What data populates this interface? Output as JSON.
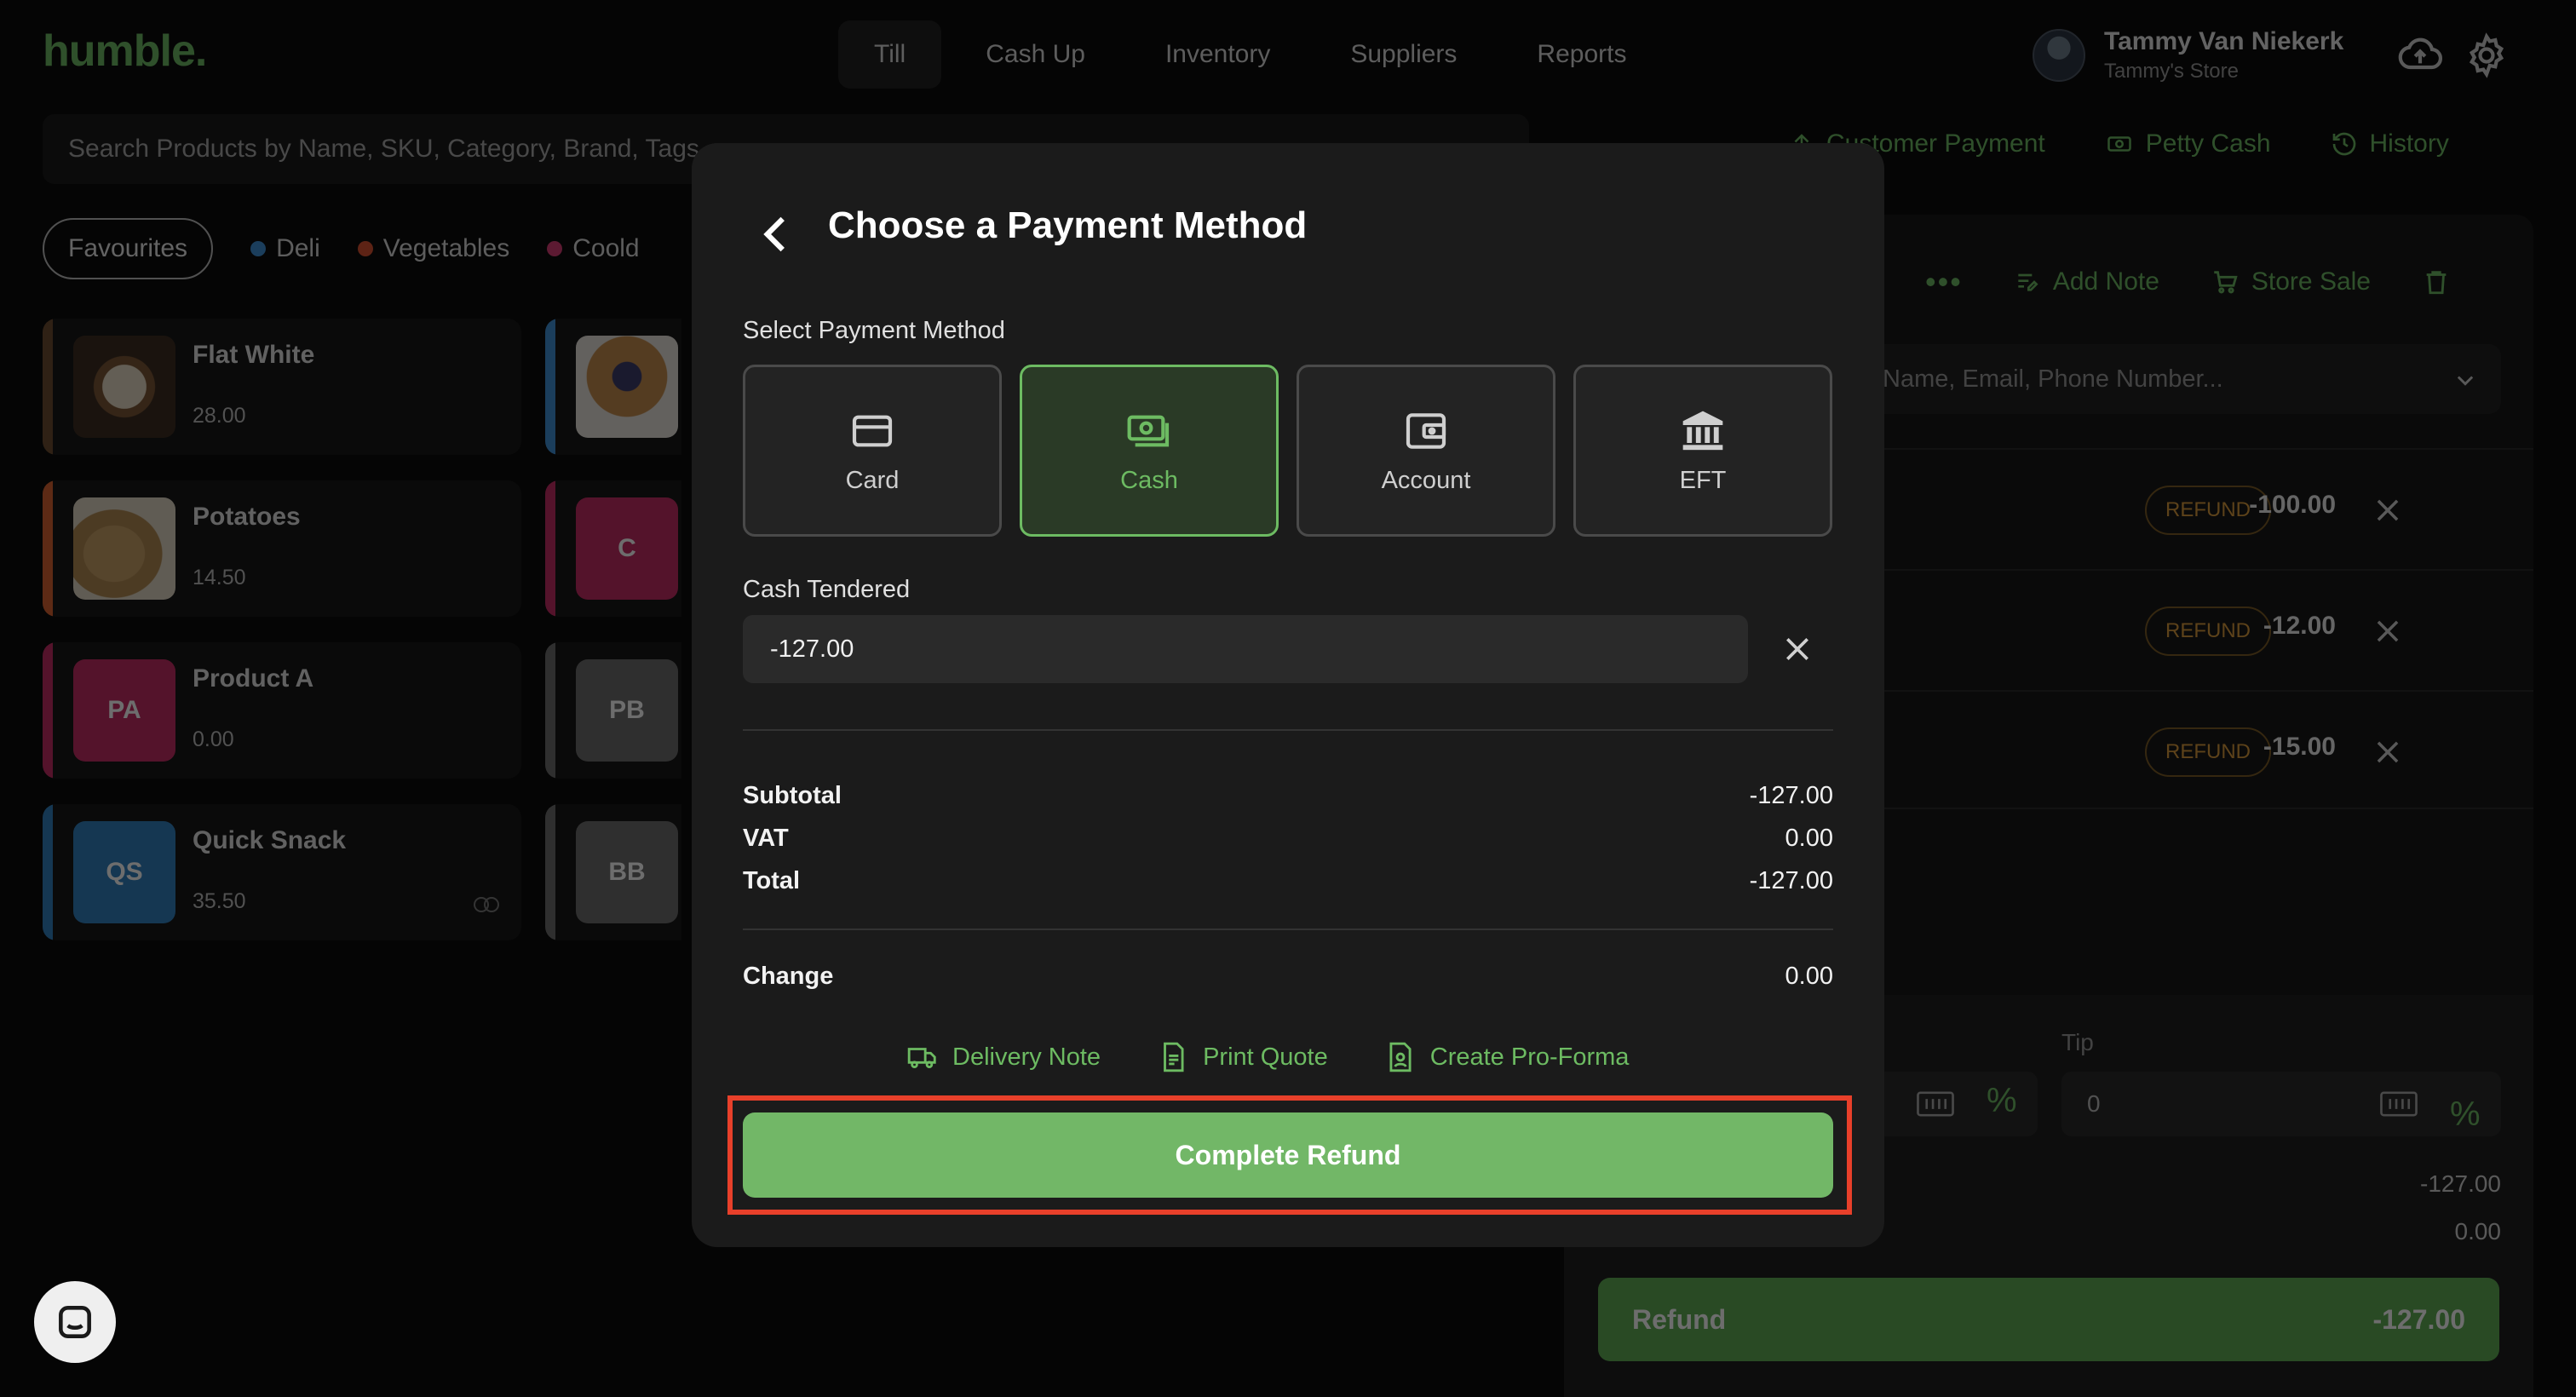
{
  "app": {
    "logo": "humble."
  },
  "nav": {
    "tabs": [
      "Till",
      "Cash Up",
      "Inventory",
      "Suppliers",
      "Reports"
    ],
    "active": "Till"
  },
  "user": {
    "name": "Tammy Van Niekerk",
    "store": "Tammy's Store"
  },
  "icons": {
    "sync": "cloud-upload-icon",
    "settings": "gear-icon"
  },
  "search": {
    "placeholder": "Search Products by Name, SKU, Category, Brand, Tags"
  },
  "categories": {
    "favourites": "Favourites",
    "items": [
      {
        "label": "Deli",
        "color": "#3d8fd6"
      },
      {
        "label": "Vegetables",
        "color": "#d8502e"
      },
      {
        "label": "Coold",
        "color": "#d63a72"
      }
    ]
  },
  "products": [
    {
      "name": "Flat White",
      "price": "28.00",
      "initials": "",
      "color": "#6b4a2e"
    },
    {
      "name": "Potatoes",
      "price": "14.50",
      "initials": "",
      "color": "#d8602e"
    },
    {
      "name": "Product A",
      "price": "0.00",
      "initials": "PA",
      "color": "#c42a62"
    },
    {
      "name": "Quick Snack",
      "price": "35.50",
      "initials": "QS",
      "color": "#2f7fbf"
    }
  ],
  "products_col2": [
    {
      "initials": "",
      "color": "#3d8fd6"
    },
    {
      "initials": "C",
      "color": "#c42a62"
    },
    {
      "initials": "PB",
      "color": "#6b6b6b"
    },
    {
      "initials": "BB",
      "color": "#6b6b6b"
    }
  ],
  "right_panel": {
    "links": [
      "Customer Payment",
      "Petty Cash",
      "History"
    ],
    "actions": {
      "add_note": "Add Note",
      "store_sale": "Store Sale"
    },
    "customer_placeholder": "Name, Email, Phone Number...",
    "lines": [
      {
        "badge": "REFUND",
        "amount": "-100.00"
      },
      {
        "badge": "REFUND",
        "amount": "-12.00"
      },
      {
        "badge": "REFUND",
        "amount": "-15.00"
      }
    ],
    "tip_label": "Tip",
    "tip_value": "0",
    "summary_total": "-127.00",
    "summary_vat": "0.00",
    "refund_label": "Refund",
    "refund_amount": "-127.00"
  },
  "modal": {
    "title": "Choose a Payment Method",
    "select_label": "Select Payment Method",
    "methods": [
      {
        "label": "Card",
        "icon": "card-icon",
        "selected": false
      },
      {
        "label": "Cash",
        "icon": "cash-icon",
        "selected": true
      },
      {
        "label": "Account",
        "icon": "wallet-icon",
        "selected": false
      },
      {
        "label": "EFT",
        "icon": "bank-icon",
        "selected": false
      }
    ],
    "cash_tendered_label": "Cash Tendered",
    "cash_tendered_value": "-127.00",
    "subtotal_label": "Subtotal",
    "subtotal_value": "-127.00",
    "vat_label": "VAT",
    "vat_value": "0.00",
    "total_label": "Total",
    "total_value": "-127.00",
    "change_label": "Change",
    "change_value": "0.00",
    "links": [
      "Delivery Note",
      "Print Quote",
      "Create Pro-Forma"
    ],
    "complete_button": "Complete Refund"
  },
  "colors": {
    "accent": "#6dbb62",
    "highlight": "#e8402a",
    "refund_badge": "#d89a3a"
  }
}
